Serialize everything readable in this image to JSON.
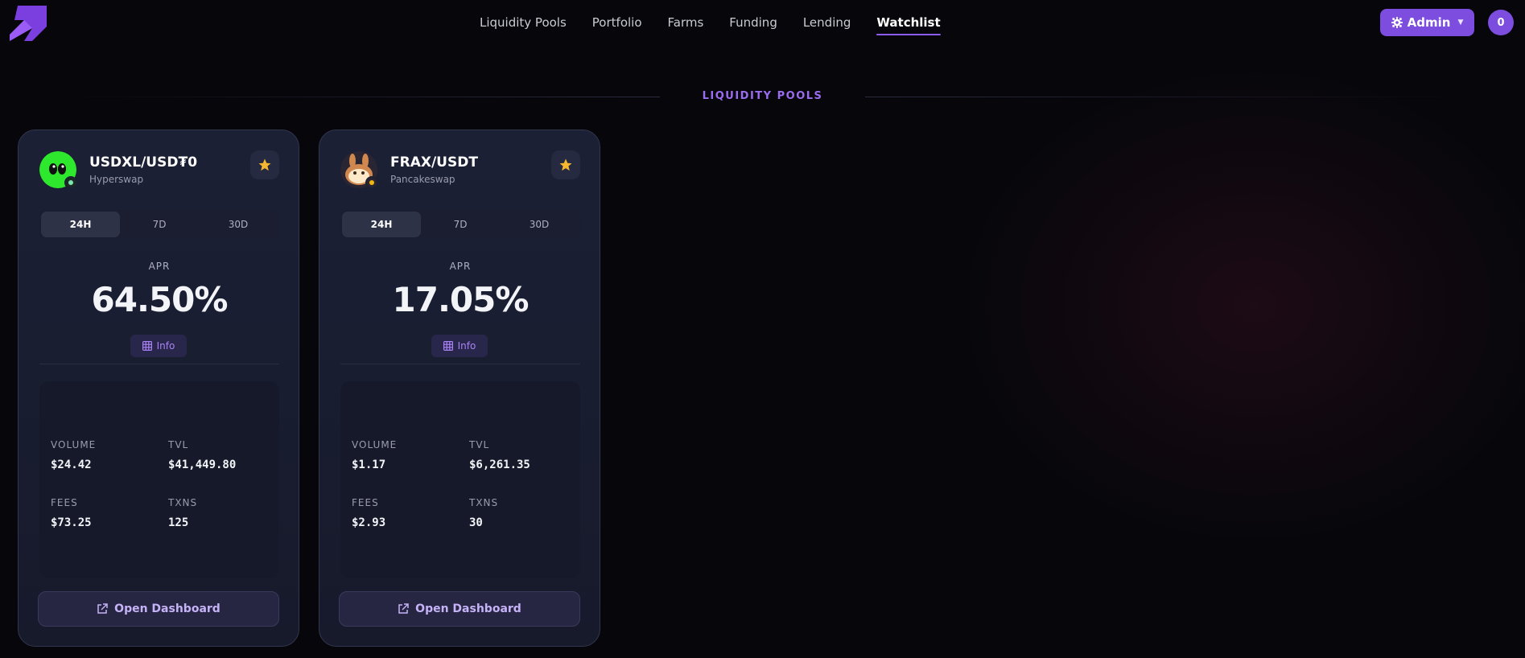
{
  "nav": {
    "items": [
      {
        "label": "Liquidity Pools",
        "active": false
      },
      {
        "label": "Portfolio",
        "active": false
      },
      {
        "label": "Farms",
        "active": false
      },
      {
        "label": "Funding",
        "active": false
      },
      {
        "label": "Lending",
        "active": false
      },
      {
        "label": "Watchlist",
        "active": true
      }
    ]
  },
  "header": {
    "admin_label": "Admin",
    "avatar_initial": "0",
    "accent_color": "#7c4ddf"
  },
  "section": {
    "title": "LIQUIDITY POOLS"
  },
  "cards": [
    {
      "pair": "USDXL/USD₮0",
      "dex": "Hyperswap",
      "icon": "hyperswap-token-icon",
      "tabs": [
        "24H",
        "7D",
        "30D"
      ],
      "active_tab": "24H",
      "apr_label": "APR",
      "apr_value": "64.50%",
      "info_label": "Info",
      "stats": {
        "volume_label": "VOLUME",
        "volume": "$24.42",
        "tvl_label": "TVL",
        "tvl": "$41,449.80",
        "fees_label": "FEES",
        "fees": "$73.25",
        "txns_label": "TXNS",
        "txns": "125"
      },
      "open_label": "Open Dashboard"
    },
    {
      "pair": "FRAX/USDT",
      "dex": "Pancakeswap",
      "icon": "pancakeswap-token-icon",
      "tabs": [
        "24H",
        "7D",
        "30D"
      ],
      "active_tab": "24H",
      "apr_label": "APR",
      "apr_value": "17.05%",
      "info_label": "Info",
      "stats": {
        "volume_label": "VOLUME",
        "volume": "$1.17",
        "tvl_label": "TVL",
        "tvl": "$6,261.35",
        "fees_label": "FEES",
        "fees": "$2.93",
        "txns_label": "TXNS",
        "txns": "30"
      },
      "open_label": "Open Dashboard"
    }
  ]
}
